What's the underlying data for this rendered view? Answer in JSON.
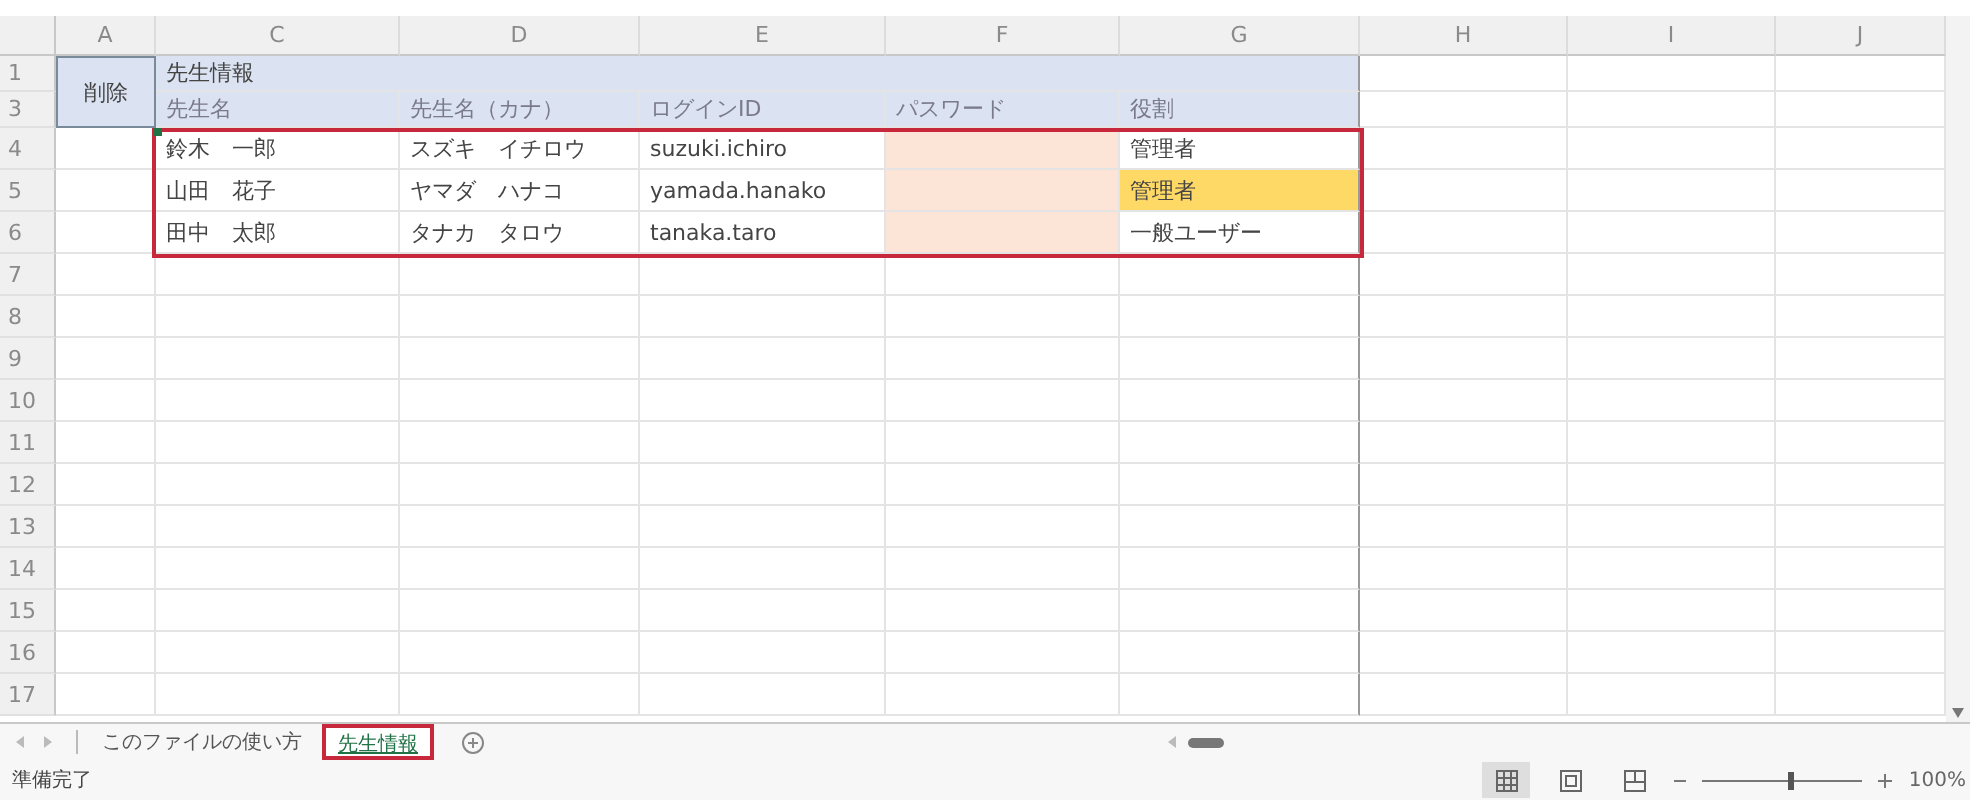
{
  "columns": [
    "A",
    "C",
    "D",
    "E",
    "F",
    "G",
    "H",
    "I",
    "J"
  ],
  "row_numbers": [
    "1",
    "3",
    "4",
    "5",
    "6",
    "7",
    "8",
    "9",
    "10",
    "11",
    "12",
    "13",
    "14",
    "15",
    "16",
    "17"
  ],
  "delete_header": "削除",
  "section_title": "先生情報",
  "headers": [
    "先生名",
    "先生名（カナ）",
    "ログインID",
    "パスワード",
    "役割"
  ],
  "teachers": [
    {
      "name": "鈴木　一郎",
      "kana": "スズキ　イチロウ",
      "login_id": "suzuki.ichiro",
      "role": "管理者",
      "role_highlighted": false
    },
    {
      "name": "山田　花子",
      "kana": "ヤマダ　ハナコ",
      "login_id": "yamada.hanako",
      "role": "管理者",
      "role_highlighted": true
    },
    {
      "name": "田中　太郎",
      "kana": "タナカ　タロウ",
      "login_id": "tanaka.taro",
      "role": "一般ユーザー",
      "role_highlighted": false
    }
  ],
  "sheet_tabs": [
    {
      "label": "このファイルの使い方",
      "selected": false
    },
    {
      "label": "先生情報",
      "selected": true
    }
  ],
  "status": "準備完了",
  "views": [
    {
      "kind": "normal",
      "selected": true
    },
    {
      "kind": "page_layout",
      "selected": false
    },
    {
      "kind": "page_break",
      "selected": false
    }
  ],
  "zoom": {
    "level": 0.55,
    "label": "100%"
  }
}
